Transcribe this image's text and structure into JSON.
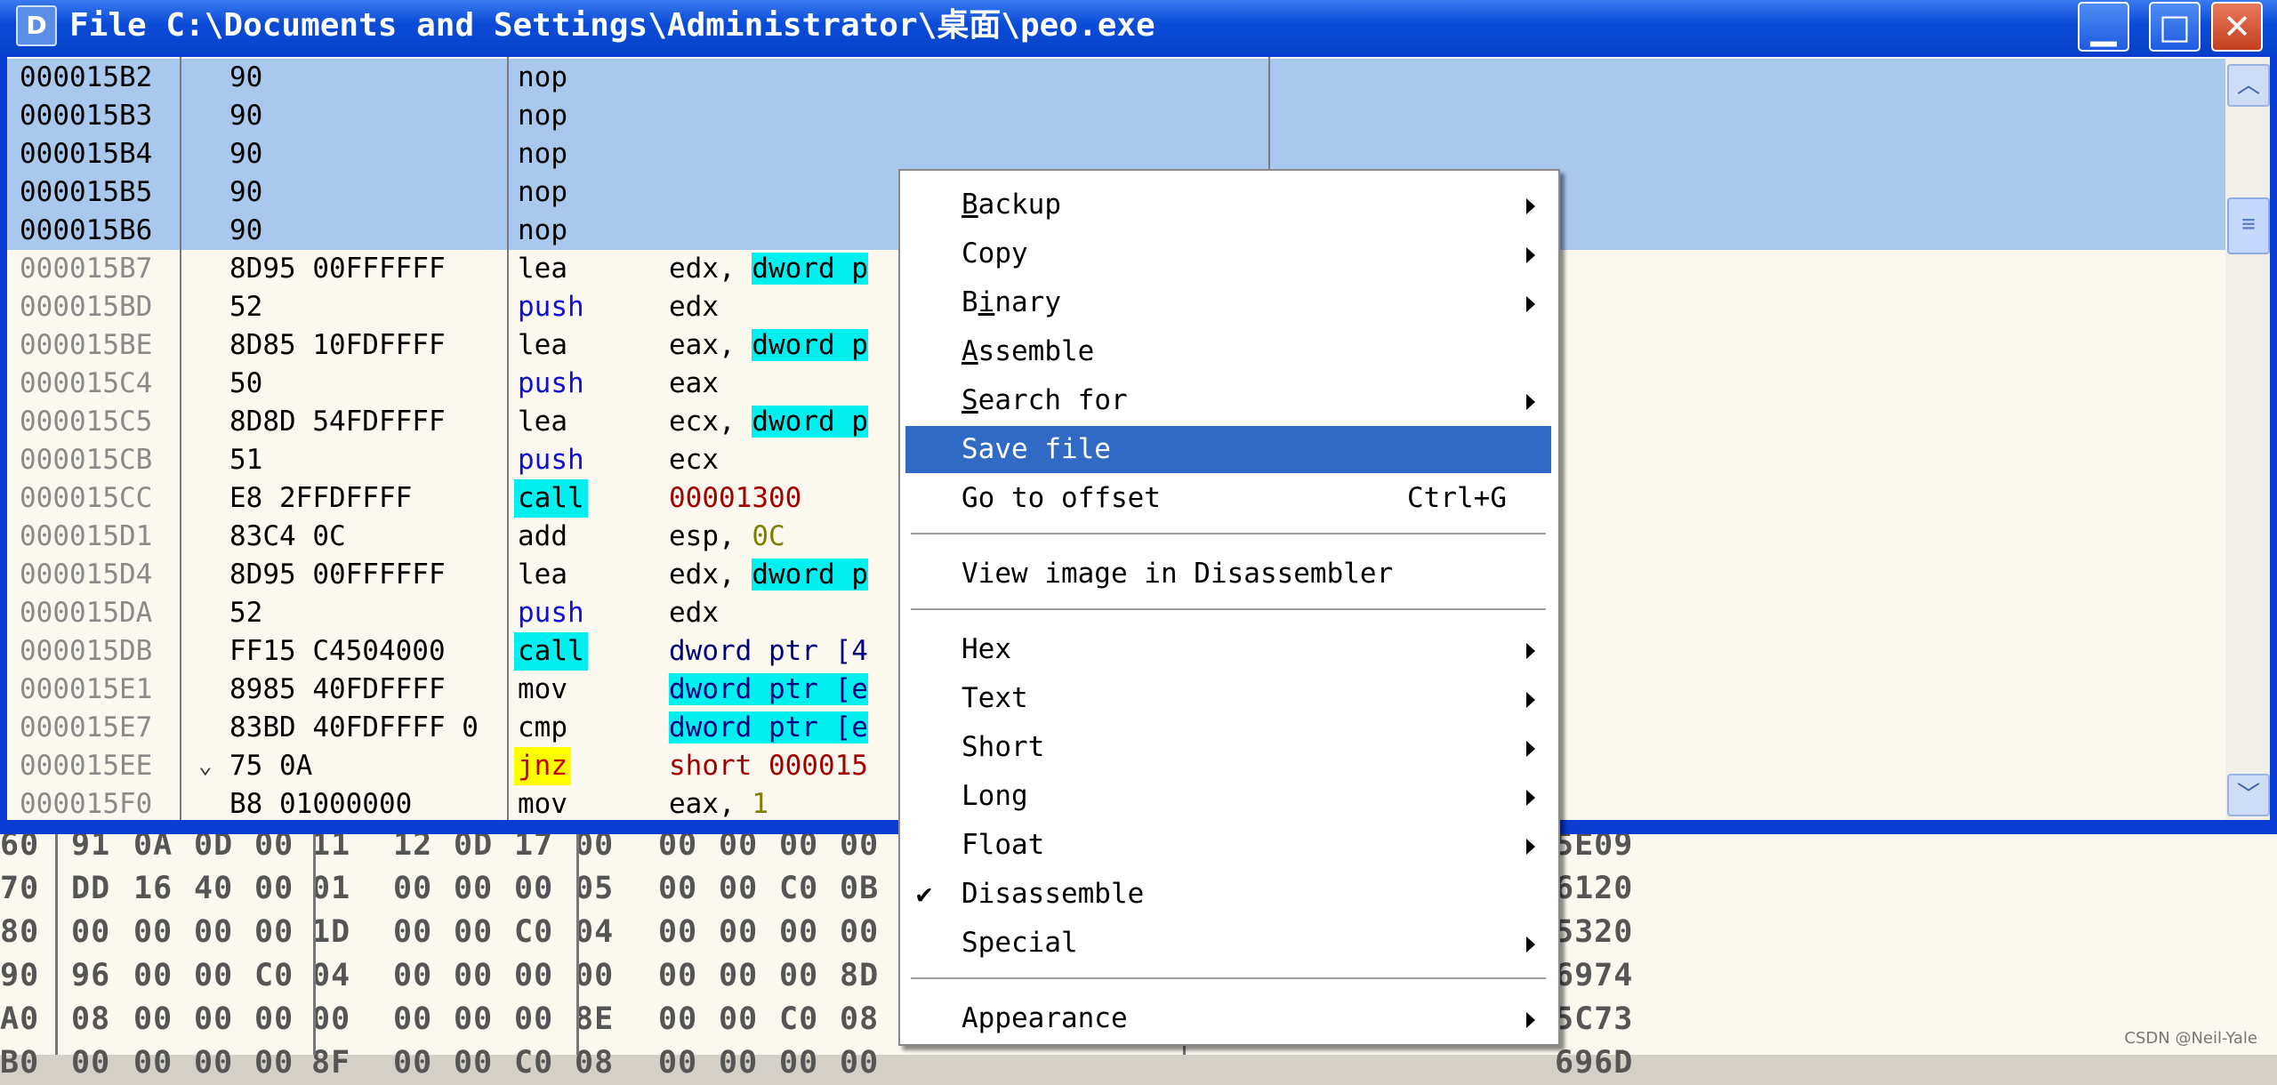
{
  "window": {
    "title": "File C:\\Documents and Settings\\Administrator\\桌面\\peo.exe",
    "icon_letter": "D",
    "buttons": {
      "minimize": "▁",
      "maximize": "□",
      "close": "✕"
    }
  },
  "listing": [
    {
      "addr": "000015B2",
      "bytes": "90",
      "mnemonic": "nop",
      "operand": []
    },
    {
      "addr": "000015B3",
      "bytes": "90",
      "mnemonic": "nop",
      "operand": []
    },
    {
      "addr": "000015B4",
      "bytes": "90",
      "mnemonic": "nop",
      "operand": []
    },
    {
      "addr": "000015B5",
      "bytes": "90",
      "mnemonic": "nop",
      "operand": []
    },
    {
      "addr": "000015B6",
      "bytes": "90",
      "mnemonic": "nop",
      "operand": []
    },
    {
      "addr": "000015B7",
      "bytes": "8D95 00FFFFFF",
      "mnemonic": "lea",
      "operand": [
        {
          "t": "edx, "
        },
        {
          "t": "dword p",
          "c": "hl-cyan"
        }
      ]
    },
    {
      "addr": "000015BD",
      "bytes": "52",
      "mnemonic": "push",
      "operand": [
        {
          "t": "edx"
        }
      ]
    },
    {
      "addr": "000015BE",
      "bytes": "8D85 10FDFFFF",
      "mnemonic": "lea",
      "operand": [
        {
          "t": "eax, "
        },
        {
          "t": "dword p",
          "c": "hl-cyan"
        }
      ]
    },
    {
      "addr": "000015C4",
      "bytes": "50",
      "mnemonic": "push",
      "operand": [
        {
          "t": "eax"
        }
      ]
    },
    {
      "addr": "000015C5",
      "bytes": "8D8D 54FDFFFF",
      "mnemonic": "lea",
      "operand": [
        {
          "t": "ecx, "
        },
        {
          "t": "dword p",
          "c": "hl-cyan"
        }
      ]
    },
    {
      "addr": "000015CB",
      "bytes": "51",
      "mnemonic": "push",
      "operand": [
        {
          "t": "ecx"
        }
      ]
    },
    {
      "addr": "000015CC",
      "bytes": "E8 2FFDFFFF",
      "mnemonic": "call",
      "operand": [
        {
          "t": "00001300",
          "c": "darkred"
        }
      ]
    },
    {
      "addr": "000015D1",
      "bytes": "83C4 0C",
      "mnemonic": "add",
      "operand": [
        {
          "t": "esp, "
        },
        {
          "t": "0C",
          "c": "olive"
        }
      ]
    },
    {
      "addr": "000015D4",
      "bytes": "8D95 00FFFFFF",
      "mnemonic": "lea",
      "operand": [
        {
          "t": "edx, "
        },
        {
          "t": "dword p",
          "c": "hl-cyan"
        }
      ]
    },
    {
      "addr": "000015DA",
      "bytes": "52",
      "mnemonic": "push",
      "operand": [
        {
          "t": "edx"
        }
      ]
    },
    {
      "addr": "000015DB",
      "bytes": "FF15 C4504000",
      "mnemonic": "call",
      "operand": [
        {
          "t": "dword ptr [4",
          "c": "navy"
        }
      ]
    },
    {
      "addr": "000015E1",
      "bytes": "8985 40FDFFFF",
      "mnemonic": "mov",
      "operand": [
        {
          "t": "dword ptr [e",
          "c": "hl-cyan navy"
        }
      ]
    },
    {
      "addr": "000015E7",
      "bytes": "83BD 40FDFFFF 0",
      "mnemonic": "cmp",
      "operand": [
        {
          "t": "dword ptr [e",
          "c": "hl-cyan navy"
        }
      ]
    },
    {
      "addr": "000015EE",
      "bytes": "75 0A",
      "mnemonic": "jnz",
      "operand": [
        {
          "t": "short 000015",
          "c": "darkred"
        }
      ],
      "jump": "⌄"
    },
    {
      "addr": "000015F0",
      "bytes": "B8 01000000",
      "mnemonic": "mov",
      "operand": [
        {
          "t": "eax, "
        },
        {
          "t": "1",
          "c": "olive"
        }
      ]
    }
  ],
  "hexdump": [
    {
      "off": "60",
      "cells": [
        "91",
        "0A",
        "0D",
        "00",
        "11",
        "12",
        "0D",
        "17",
        "00",
        "00",
        "00",
        "00",
        "00"
      ],
      "tail": "5E09"
    },
    {
      "off": "70",
      "cells": [
        "DD",
        "16",
        "40",
        "00",
        "01",
        "00",
        "00",
        "00",
        "05",
        "00",
        "00",
        "C0",
        "0B"
      ],
      "tail": "6120"
    },
    {
      "off": "80",
      "cells": [
        "00",
        "00",
        "00",
        "00",
        "1D",
        "00",
        "00",
        "C0",
        "04",
        "00",
        "00",
        "00",
        "00"
      ],
      "tail": "5320"
    },
    {
      "off": "90",
      "cells": [
        "96",
        "00",
        "00",
        "C0",
        "04",
        "00",
        "00",
        "00",
        "00",
        "00",
        "00",
        "00",
        "8D"
      ],
      "tail": "6974"
    },
    {
      "off": "A0",
      "cells": [
        "08",
        "00",
        "00",
        "00",
        "00",
        "00",
        "00",
        "00",
        "8E",
        "00",
        "00",
        "C0",
        "08"
      ],
      "tail": "5C73"
    },
    {
      "off": "B0",
      "cells": [
        "00",
        "00",
        "00",
        "00",
        "8F",
        "00",
        "00",
        "C0",
        "08",
        "00",
        "00",
        "00",
        "00"
      ],
      "tail": "696D"
    }
  ],
  "context_menu": {
    "items": [
      {
        "type": "item",
        "label": "Backup",
        "ul": 0,
        "submenu": true
      },
      {
        "type": "item",
        "label": "Copy",
        "submenu": true
      },
      {
        "type": "item",
        "label": "Binary",
        "ul": 1,
        "submenu": true
      },
      {
        "type": "item",
        "label": "Assemble",
        "ul": 0
      },
      {
        "type": "item",
        "label": "Search for",
        "ul": 0,
        "submenu": true
      },
      {
        "type": "item",
        "label": "Save file",
        "highlighted": true
      },
      {
        "type": "item",
        "label": "Go to offset",
        "shortcut": "Ctrl+G"
      },
      {
        "type": "sep"
      },
      {
        "type": "item",
        "label": "View image in Disassembler"
      },
      {
        "type": "sep"
      },
      {
        "type": "item",
        "label": "Hex",
        "submenu": true
      },
      {
        "type": "item",
        "label": "Text",
        "submenu": true
      },
      {
        "type": "item",
        "label": "Short",
        "submenu": true
      },
      {
        "type": "item",
        "label": "Long",
        "submenu": true
      },
      {
        "type": "item",
        "label": "Float",
        "submenu": true
      },
      {
        "type": "item",
        "label": "Disassemble",
        "checked": true
      },
      {
        "type": "item",
        "label": "Special",
        "submenu": true
      },
      {
        "type": "sep"
      },
      {
        "type": "item",
        "label": "Appearance",
        "submenu": true
      }
    ],
    "check_glyph": "✔"
  },
  "watermark": "CSDN @Neil-Yale",
  "colors": {
    "selection": "#a8c8ee",
    "menu_highlight": "#316ac5",
    "cyan": "#00f0f0",
    "yellow": "#ffff00"
  }
}
